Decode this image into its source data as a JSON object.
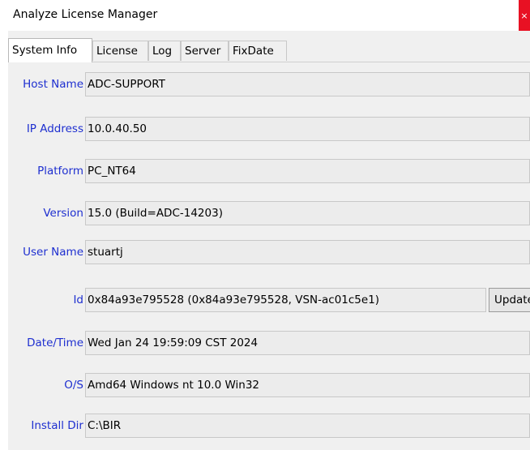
{
  "window": {
    "title": "Analyze License Manager",
    "close_glyph": "×"
  },
  "tabs": [
    {
      "label": "System Info"
    },
    {
      "label": "License"
    },
    {
      "label": "Log"
    },
    {
      "label": "Server"
    },
    {
      "label": "FixDate"
    }
  ],
  "fields": {
    "host_name": {
      "label": "Host Name",
      "value": "ADC-SUPPORT"
    },
    "ip_address": {
      "label": "IP Address",
      "value": "10.0.40.50"
    },
    "platform": {
      "label": "Platform",
      "value": "PC_NT64"
    },
    "version": {
      "label": "Version",
      "value": "15.0  (Build=ADC-14203)"
    },
    "user_name": {
      "label": "User Name",
      "value": "stuartj"
    },
    "id": {
      "label": "Id",
      "value": "0x84a93e795528  (0x84a93e795528, VSN-ac01c5e1)"
    },
    "date_time": {
      "label": "Date/Time",
      "value": "Wed Jan 24 19:59:09 CST 2024"
    },
    "os": {
      "label": "O/S",
      "value": "Amd64 Windows nt 10.0 Win32"
    },
    "install_dir": {
      "label": "Install Dir",
      "value": "C:\\BIR"
    }
  },
  "buttons": {
    "update_label": "Update"
  },
  "colors": {
    "label": "#1e2fd0",
    "close": "#e81123",
    "panel": "#f0f0f0"
  }
}
